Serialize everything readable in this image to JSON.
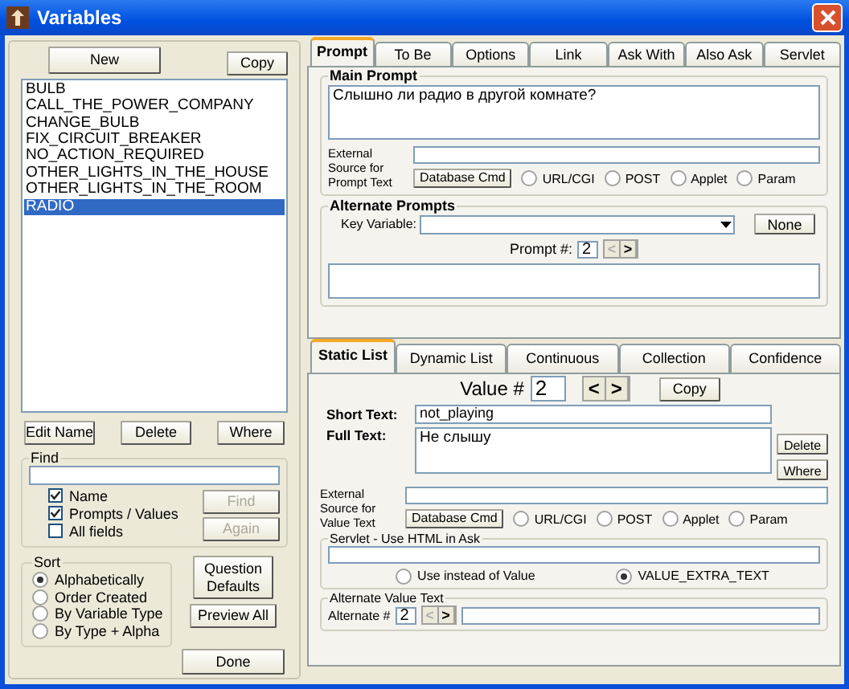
{
  "window": {
    "title": "Variables"
  },
  "variables": {
    "new_button": "New",
    "copy_button": "Copy",
    "items": [
      {
        "label": "BULB",
        "selected": false
      },
      {
        "label": "CALL_THE_POWER_COMPANY",
        "selected": false
      },
      {
        "label": "CHANGE_BULB",
        "selected": false
      },
      {
        "label": "FIX_CIRCUIT_BREAKER",
        "selected": false
      },
      {
        "label": "NO_ACTION_REQUIRED",
        "selected": false
      },
      {
        "label": "OTHER_LIGHTS_IN_THE_HOUSE",
        "selected": false
      },
      {
        "label": "OTHER_LIGHTS_IN_THE_ROOM",
        "selected": false
      },
      {
        "label": "RADIO",
        "selected": true
      }
    ],
    "actions": [
      "Edit Name",
      "Delete",
      "Where"
    ]
  },
  "find": {
    "title": "Find",
    "options": [
      {
        "label": "Name",
        "checked": true
      },
      {
        "label": "Prompts / Values",
        "checked": true
      },
      {
        "label": "All fields",
        "checked": false
      }
    ],
    "buttons": [
      {
        "label": "Find",
        "disabled": true
      },
      {
        "label": "Again",
        "disabled": true
      }
    ]
  },
  "sort": {
    "title": "Sort",
    "options": [
      {
        "label": "Alphabetically",
        "selected": true
      },
      {
        "label": "Order Created",
        "selected": false
      },
      {
        "label": "By Variable Type",
        "selected": false
      },
      {
        "label": "By Type + Alpha",
        "selected": false
      }
    ]
  },
  "side_buttons": [
    "Question Defaults",
    "Preview All",
    "Done"
  ],
  "prompt_tabs": [
    {
      "label": "Prompt",
      "selected": true
    },
    {
      "label": "To Be",
      "selected": false
    },
    {
      "label": "Options",
      "selected": false
    },
    {
      "label": "Link",
      "selected": false
    },
    {
      "label": "Ask With",
      "selected": false
    },
    {
      "label": "Also Ask",
      "selected": false
    },
    {
      "label": "Servlet",
      "selected": false
    }
  ],
  "main_prompt": {
    "title": "Main Prompt",
    "value": "Слышно ли радио в другой комнате?",
    "external_label": "External Source for Prompt Text",
    "database_button": "Database Cmd",
    "source_options": [
      {
        "label": "URL/CGI",
        "selected": false
      },
      {
        "label": "POST",
        "selected": false
      },
      {
        "label": "Applet",
        "selected": false
      },
      {
        "label": "Param",
        "selected": false
      }
    ]
  },
  "alternate_prompts": {
    "title": "Alternate Prompts",
    "key_label": "Key Variable:",
    "none_button": "None",
    "prompt_label": "Prompt #:",
    "prompt_number": "2",
    "prev": {
      "label": "<",
      "disabled": true
    },
    "next": {
      "label": ">",
      "disabled": false
    }
  },
  "value_tabs": [
    {
      "label": "Static List",
      "selected": true
    },
    {
      "label": "Dynamic List",
      "selected": false
    },
    {
      "label": "Continuous",
      "selected": false
    },
    {
      "label": "Collection",
      "selected": false
    },
    {
      "label": "Confidence",
      "selected": false
    }
  ],
  "value": {
    "label": "Value #",
    "number": "2",
    "prev": {
      "label": "<",
      "disabled": false
    },
    "next": {
      "label": ">",
      "disabled": false
    },
    "copy_button": "Copy",
    "short_label": "Short Text:",
    "short_value": "not_playing",
    "full_label": "Full Text:",
    "full_value": "Не слышу",
    "delete_button": "Delete",
    "where_button": "Where",
    "external_label": "External Source for Value Text",
    "database_button": "Database Cmd",
    "source_options": [
      {
        "label": "URL/CGI",
        "selected": false
      },
      {
        "label": "POST",
        "selected": false
      },
      {
        "label": "Applet",
        "selected": false
      },
      {
        "label": "Param",
        "selected": false
      }
    ]
  },
  "servlet": {
    "title": "Servlet - Use HTML in Ask",
    "options": [
      {
        "label": "Use instead of Value",
        "selected": false
      },
      {
        "label": "VALUE_EXTRA_TEXT",
        "selected": true
      }
    ]
  },
  "alternate_value": {
    "title": "Alternate Value Text",
    "label": "Alternate #",
    "number": "2",
    "prev": {
      "label": "<",
      "disabled": true
    },
    "next": {
      "label": ">",
      "disabled": false
    }
  }
}
